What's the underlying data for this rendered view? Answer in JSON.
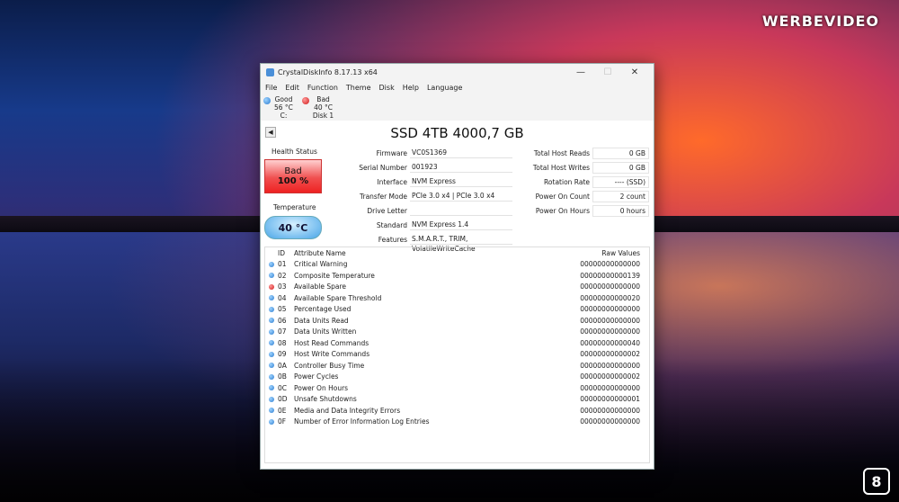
{
  "watermark": "WERBEVIDEO",
  "corner_logo": "8",
  "window": {
    "title": "CrystalDiskInfo 8.17.13 x64",
    "minimize": "—",
    "maximize": "☐",
    "close": "✕"
  },
  "menu": [
    "File",
    "Edit",
    "Function",
    "Theme",
    "Disk",
    "Help",
    "Language"
  ],
  "disks": [
    {
      "status": "Good",
      "temp": "56 °C",
      "name": "C:",
      "color": "blue"
    },
    {
      "status": "Bad",
      "temp": "40 °C",
      "name": "Disk 1",
      "color": "red"
    }
  ],
  "model": "SSD 4TB 4000,7 GB",
  "health": {
    "label": "Health Status",
    "status": "Bad",
    "percent": "100 %"
  },
  "temperature": {
    "label": "Temperature",
    "value": "40 °C"
  },
  "info": [
    {
      "key": "Firmware",
      "value": "VC0S1369"
    },
    {
      "key": "Serial Number",
      "value": "001923"
    },
    {
      "key": "Interface",
      "value": "NVM Express"
    },
    {
      "key": "Transfer Mode",
      "value": "PCIe 3.0 x4 | PCIe 3.0 x4"
    },
    {
      "key": "Drive Letter",
      "value": ""
    },
    {
      "key": "Standard",
      "value": "NVM Express 1.4"
    },
    {
      "key": "Features",
      "value": "S.M.A.R.T., TRIM, VolatileWriteCache"
    }
  ],
  "stats": [
    {
      "key": "Total Host Reads",
      "value": "0 GB"
    },
    {
      "key": "Total Host Writes",
      "value": "0 GB"
    },
    {
      "key": "Rotation Rate",
      "value": "---- (SSD)"
    },
    {
      "key": "Power On Count",
      "value": "2 count"
    },
    {
      "key": "Power On Hours",
      "value": "0 hours"
    }
  ],
  "table": {
    "headers": {
      "id": "ID",
      "name": "Attribute Name",
      "raw": "Raw Values"
    },
    "rows": [
      {
        "status": "blue",
        "id": "01",
        "name": "Critical Warning",
        "raw": "00000000000000"
      },
      {
        "status": "blue",
        "id": "02",
        "name": "Composite Temperature",
        "raw": "00000000000139"
      },
      {
        "status": "red",
        "id": "03",
        "name": "Available Spare",
        "raw": "00000000000000"
      },
      {
        "status": "blue",
        "id": "04",
        "name": "Available Spare Threshold",
        "raw": "00000000000020"
      },
      {
        "status": "blue",
        "id": "05",
        "name": "Percentage Used",
        "raw": "00000000000000"
      },
      {
        "status": "blue",
        "id": "06",
        "name": "Data Units Read",
        "raw": "00000000000000"
      },
      {
        "status": "blue",
        "id": "07",
        "name": "Data Units Written",
        "raw": "00000000000000"
      },
      {
        "status": "blue",
        "id": "08",
        "name": "Host Read Commands",
        "raw": "00000000000040"
      },
      {
        "status": "blue",
        "id": "09",
        "name": "Host Write Commands",
        "raw": "00000000000002"
      },
      {
        "status": "blue",
        "id": "0A",
        "name": "Controller Busy Time",
        "raw": "00000000000000"
      },
      {
        "status": "blue",
        "id": "0B",
        "name": "Power Cycles",
        "raw": "00000000000002"
      },
      {
        "status": "blue",
        "id": "0C",
        "name": "Power On Hours",
        "raw": "00000000000000"
      },
      {
        "status": "blue",
        "id": "0D",
        "name": "Unsafe Shutdowns",
        "raw": "00000000000001"
      },
      {
        "status": "blue",
        "id": "0E",
        "name": "Media and Data Integrity Errors",
        "raw": "00000000000000"
      },
      {
        "status": "blue",
        "id": "0F",
        "name": "Number of Error Information Log Entries",
        "raw": "00000000000000"
      }
    ]
  }
}
